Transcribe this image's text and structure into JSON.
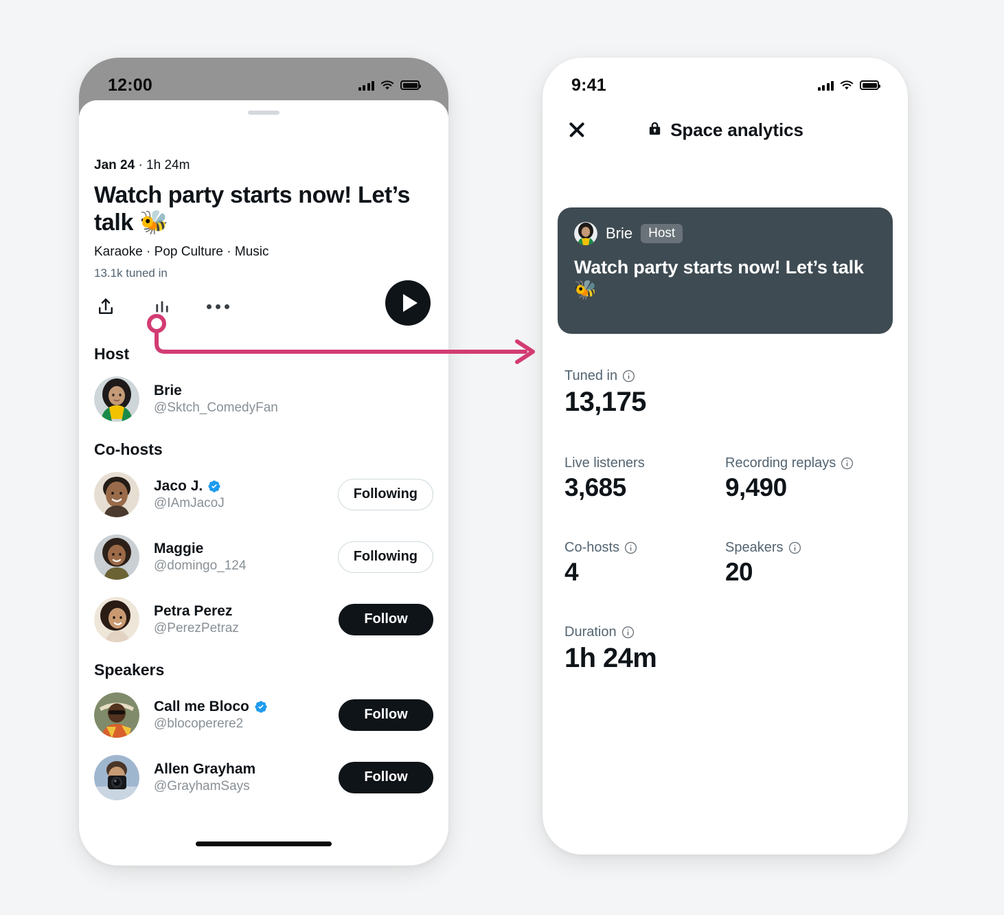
{
  "background_color": "#F4F5F6",
  "accent_pink": "#D23C73",
  "left_phone": {
    "status_bar": {
      "time": "12:00",
      "signal_icon": "cellular-bars-icon",
      "wifi_icon": "wifi-icon",
      "battery_icon": "battery-full-icon"
    },
    "space": {
      "date": "Jan 24",
      "separator": "·",
      "duration": "1h 24m",
      "title": "Watch party starts now! Let’s talk 🐝",
      "topics": "Karaoke · Pop Culture · Music",
      "tuned_in": "13.1k tuned in"
    },
    "actions": {
      "share_icon": "share-icon",
      "analytics_icon": "analytics-bars-icon",
      "more_icon": "more-dots-icon",
      "play_icon": "play-icon"
    },
    "sections": [
      {
        "heading": "Host",
        "people": [
          {
            "name": "Brie",
            "handle": "@Sktch_ComedyFan",
            "verified": false,
            "button": null
          }
        ]
      },
      {
        "heading": "Co-hosts",
        "people": [
          {
            "name": "Jaco J.",
            "handle": "@IAmJacoJ",
            "verified": true,
            "button": "Following"
          },
          {
            "name": "Maggie",
            "handle": "@domingo_124",
            "verified": false,
            "button": "Following"
          },
          {
            "name": "Petra Perez",
            "handle": "@PerezPetraz",
            "verified": false,
            "button": "Follow"
          }
        ]
      },
      {
        "heading": "Speakers",
        "people": [
          {
            "name": "Call me Bloco",
            "handle": "@blocoperere2",
            "verified": true,
            "button": "Follow"
          },
          {
            "name": "Allen Grayham",
            "handle": "@GrayhamSays",
            "verified": false,
            "button": "Follow"
          }
        ]
      }
    ]
  },
  "right_phone": {
    "status_bar": {
      "time": "9:41",
      "signal_icon": "cellular-bars-icon",
      "wifi_icon": "wifi-icon",
      "battery_icon": "battery-full-icon"
    },
    "header": {
      "close_icon": "close-x-icon",
      "lock_icon": "lock-icon",
      "title": "Space analytics"
    },
    "card": {
      "background_color": "#3E4B53",
      "avatar_icon": "brie-avatar",
      "name": "Brie",
      "role_badge": "Host",
      "title": "Watch party starts now! Let’s talk 🐝"
    },
    "stats": {
      "tuned_in": {
        "label": "Tuned in",
        "value": "13,175",
        "info_icon": "info-icon"
      },
      "live_listeners": {
        "label": "Live listeners",
        "value": "3,685",
        "info_icon": "info-icon"
      },
      "recording_replays": {
        "label": "Recording replays",
        "value": "9,490",
        "info_icon": "info-icon"
      },
      "co_hosts": {
        "label": "Co-hosts",
        "value": "4",
        "info_icon": "info-icon"
      },
      "speakers": {
        "label": "Speakers",
        "value": "20",
        "info_icon": "info-icon"
      },
      "duration": {
        "label": "Duration",
        "value": "1h 24m",
        "info_icon": "info-icon"
      }
    }
  }
}
